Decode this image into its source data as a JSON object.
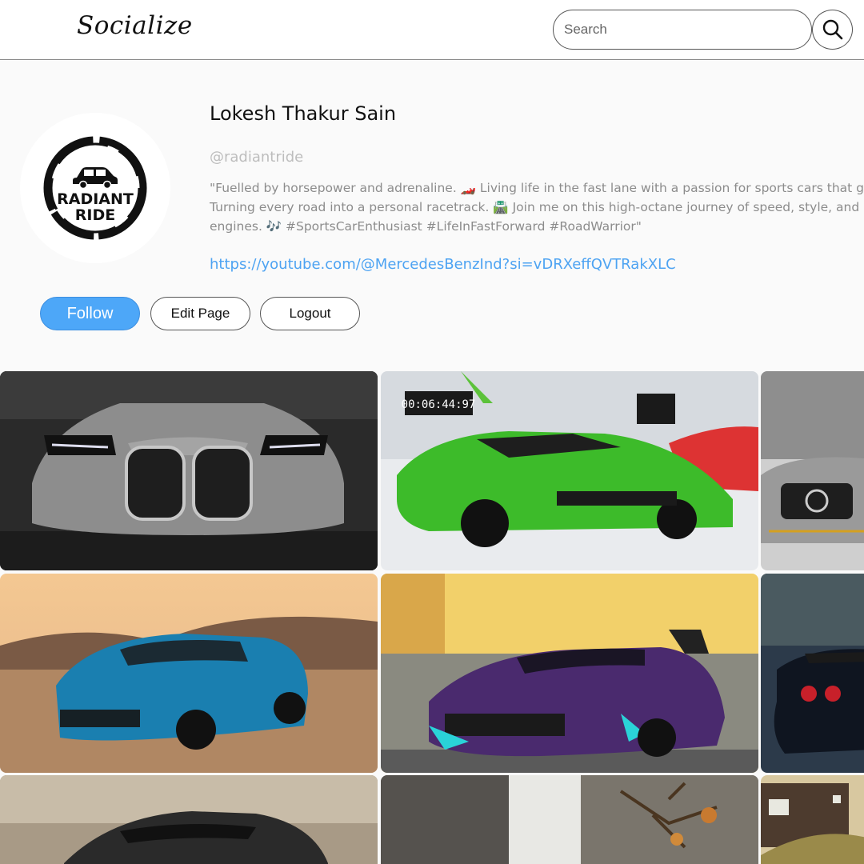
{
  "header": {
    "brand": "Socialize",
    "search_placeholder": "Search",
    "search_icon": "search-icon"
  },
  "profile": {
    "avatar_logo": "RADIANT RIDE",
    "name": "Lokesh Thakur Sain",
    "handle": "@radiantride",
    "bio_lines": [
      "\"Fuelled by horsepower and adrenaline. 🏎️ Living life in the fast lane with a passion for sports cars that go",
      "Turning every road into a personal racetrack. 🛣️ Join me on this high-octane journey of speed, style, and",
      "engines. 🎶 #SportsCarEnthusiast #LifeInFastForward #RoadWarrior\""
    ],
    "link": "https://youtube.com/@MercedesBenzInd?si=vDRXeffQVTRakXLC"
  },
  "actions": {
    "follow": "Follow",
    "edit": "Edit Page",
    "logout": "Logout"
  },
  "colors": {
    "accent": "#4da7f8",
    "link": "#4da3f2",
    "background": "#fafafa"
  },
  "posts": [
    {
      "subject": "grey BMW M4 front view"
    },
    {
      "subject": "green Lamborghini Aventador SVJ in showroom"
    },
    {
      "subject": "silver Mercedes-AMG GT front"
    },
    {
      "subject": "blue Chevrolet Camaro in desert"
    },
    {
      "subject": "purple Corvette with teal accents"
    },
    {
      "subject": "black Nissan GT-R rear"
    },
    {
      "subject": "dark sports car in field"
    },
    {
      "subject": "house and tree scene"
    },
    {
      "subject": "house with hillside"
    }
  ]
}
